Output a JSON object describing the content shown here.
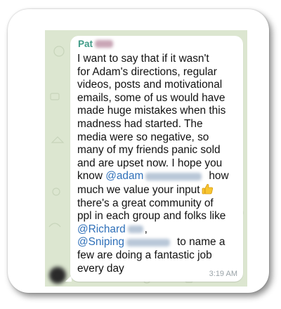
{
  "message": {
    "sender_visible": "Pat",
    "lines": [
      "I want to say that if it wasn't",
      "for Adam's directions, regular",
      "videos, posts and motivational",
      "emails, some of us would have",
      "made huge mistakes when this",
      "madness had started. The",
      "media were so negative, so",
      "many of my friends panic sold",
      "and are upset now. I hope you"
    ],
    "line_know_prefix": "know ",
    "mention_adam": "@adam",
    "line_know_suffix": "how",
    "line_value": "much we value your input",
    "line_community": "there's a great community of",
    "line_ppl": "ppl in each group and folks like",
    "mention_richard": "@Richard",
    "comma": ",",
    "mention_sniping": "@Sniping",
    "line_sniping_suffix": "to name a",
    "line_few": "few are doing a fantastic job",
    "line_everyday": "every day",
    "time": "3:19 AM",
    "emoji": "thumbs-up-icon"
  },
  "colors": {
    "sender": "#3e9a86",
    "mention": "#2e6fb8",
    "chat_background": "#dce6d0",
    "bubble": "#ffffff"
  }
}
